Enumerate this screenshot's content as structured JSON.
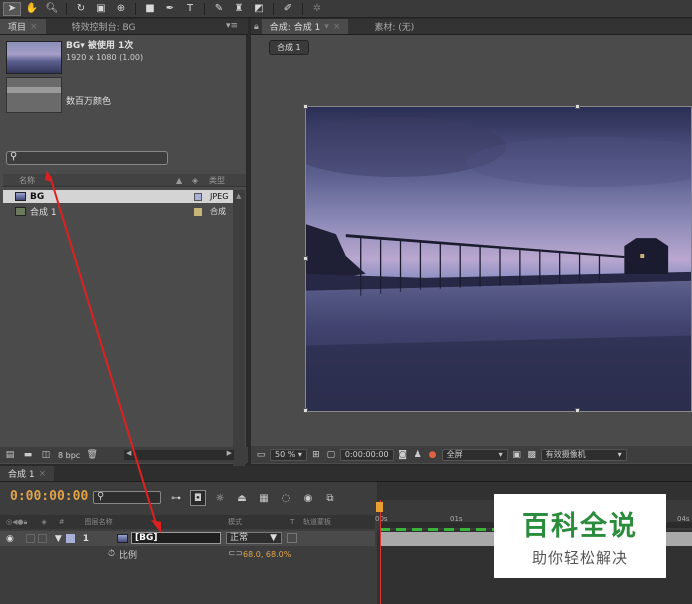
{
  "project": {
    "tab_label": "项目",
    "effect_tab_label": "特效控制台: BG",
    "menu_glyph": "▾≡",
    "asset_meta_name": "BG▾ 被使用 1次",
    "asset_meta_size": "1920 x 1080 (1.00)",
    "asset_meta_colors": "数百万颜色",
    "col_name": "名称",
    "col_type": "类型",
    "rows": [
      {
        "name": "BG",
        "type": "JPEG",
        "swatch": "#a8b0d8"
      },
      {
        "name": "合成 1",
        "type": "合成",
        "swatch": "#c8b378"
      }
    ],
    "bpc": "8 bpc"
  },
  "composition": {
    "tab_label": "合成: 合成 1",
    "footage_tab_label": "素材: (无)",
    "breadcrumb": "合成 1",
    "zoom": "50 %",
    "timecode": "0:00:00:00",
    "resolution": "全屏",
    "camera": "有效摄像机"
  },
  "timeline": {
    "tab_label": "合成 1",
    "timecode": "0:00:00:00",
    "col_layer_name": "图层名称",
    "col_mode": "模式",
    "col_t": "T",
    "col_trkmat": "轨道蒙板",
    "col_num": "#",
    "layer_number": "1",
    "layer_name": "[BG]",
    "layer_mode": "正常",
    "prop_name": "比例",
    "prop_value": "68.0, 68.0%",
    "ruler_0": "00s",
    "ruler_1": "01s",
    "ruler_end": "04s"
  },
  "watermark": {
    "title": "百科全说",
    "subtitle": "助你轻松解决"
  }
}
